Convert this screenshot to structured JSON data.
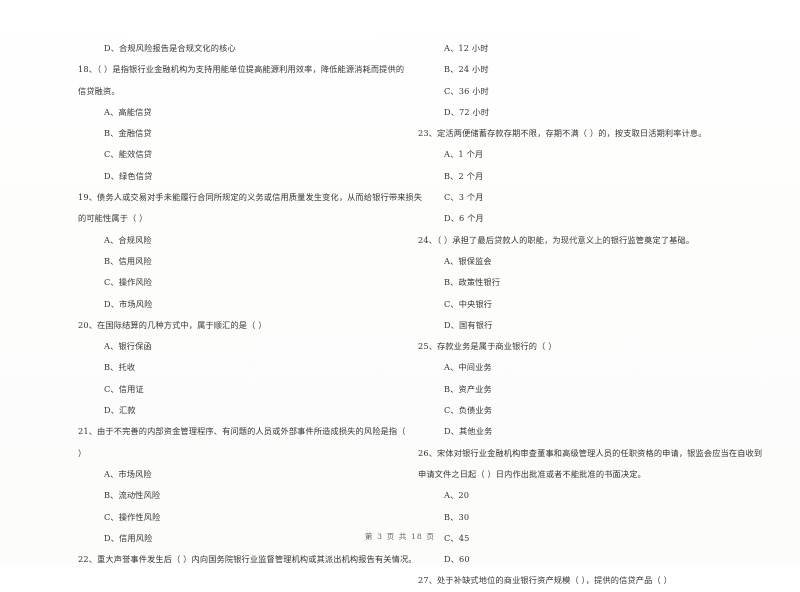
{
  "document": {
    "type": "exam-paper",
    "language": "zh-CN",
    "footer": "第 3 页 共 18 页"
  },
  "left_column": {
    "lines": [
      {
        "kind": "opt",
        "text": "D、合规风险报告是合规文化的核心"
      },
      {
        "kind": "q",
        "text": "18、（      ）是指银行业金融机构为支持用能单位提高能源利用效率，降低能源消耗而提供的"
      },
      {
        "kind": "cont",
        "text": "信贷融资。"
      },
      {
        "kind": "opt",
        "text": "A、高能信贷"
      },
      {
        "kind": "opt",
        "text": "B、金融信贷"
      },
      {
        "kind": "opt",
        "text": "C、能效信贷"
      },
      {
        "kind": "opt",
        "text": "D、绿色信贷"
      },
      {
        "kind": "q",
        "text": "19、债务人或交易对手未能履行合同所规定的义务或信用质量发生变化，从而给银行带来损失"
      },
      {
        "kind": "cont",
        "text": "的可能性属于（      ）"
      },
      {
        "kind": "opt",
        "text": "A、合规风险"
      },
      {
        "kind": "opt",
        "text": "B、信用风险"
      },
      {
        "kind": "opt",
        "text": "C、操作风险"
      },
      {
        "kind": "opt",
        "text": "D、市场风险"
      },
      {
        "kind": "q",
        "text": "20、在国际结算的几种方式中，属于顺汇的是（      ）"
      },
      {
        "kind": "opt",
        "text": "A、银行保函"
      },
      {
        "kind": "opt",
        "text": "B、托收"
      },
      {
        "kind": "opt",
        "text": "C、信用证"
      },
      {
        "kind": "opt",
        "text": "D、汇款"
      },
      {
        "kind": "q",
        "text": "21、由于不完善的内部资金管理程序、有问题的人员或外部事件所造成损失的风险是指（"
      },
      {
        "kind": "cont",
        "text": "）"
      },
      {
        "kind": "opt",
        "text": "A、市场风险"
      },
      {
        "kind": "opt",
        "text": "B、流动性风险"
      },
      {
        "kind": "opt",
        "text": "C、操作性风险"
      },
      {
        "kind": "opt",
        "text": "D、信用风险"
      },
      {
        "kind": "q",
        "text": "22、重大声誉事件发生后（      ）内向国务院银行业监督管理机构或其派出机构报告有关情况。"
      }
    ]
  },
  "right_column": {
    "lines": [
      {
        "kind": "opt",
        "text": "A、12 小时"
      },
      {
        "kind": "opt",
        "text": "B、24 小时"
      },
      {
        "kind": "opt",
        "text": "C、36 小时"
      },
      {
        "kind": "opt",
        "text": "D、72 小时"
      },
      {
        "kind": "q",
        "text": "23、定活两便储蓄存款存期不限，存期不满（      ）的，按支取日活期利率计息。"
      },
      {
        "kind": "opt",
        "text": "A、1 个月"
      },
      {
        "kind": "opt",
        "text": "B、2 个月"
      },
      {
        "kind": "opt",
        "text": "C、3 个月"
      },
      {
        "kind": "opt",
        "text": "D、6 个月"
      },
      {
        "kind": "q",
        "text": "24、（      ）承担了最后贷款人的职能，为现代意义上的银行监管奠定了基础。"
      },
      {
        "kind": "opt",
        "text": "A、银保监会"
      },
      {
        "kind": "opt",
        "text": "B、政策性银行"
      },
      {
        "kind": "opt",
        "text": "C、中央银行"
      },
      {
        "kind": "opt",
        "text": "D、国有银行"
      },
      {
        "kind": "q",
        "text": "25、存款业务是属于商业银行的（      ）"
      },
      {
        "kind": "opt",
        "text": "A、中间业务"
      },
      {
        "kind": "opt",
        "text": "B、资产业务"
      },
      {
        "kind": "opt",
        "text": "C、负债业务"
      },
      {
        "kind": "opt",
        "text": "D、其他业务"
      },
      {
        "kind": "q",
        "text": "26、宋体对银行业金融机构审查董事和高级管理人员的任职资格的申请，银监会应当在自收到"
      },
      {
        "kind": "cont",
        "text": "申请文件之日起（      ）日内作出批准或者不能批准的书面决定。"
      },
      {
        "kind": "opt",
        "text": "A、20"
      },
      {
        "kind": "opt",
        "text": "B、30"
      },
      {
        "kind": "opt",
        "text": "C、45"
      },
      {
        "kind": "opt",
        "text": "D、60"
      },
      {
        "kind": "q",
        "text": "27、处于补缺式地位的商业银行资产规模（      ），提供的信贷产品（      ）"
      }
    ]
  }
}
